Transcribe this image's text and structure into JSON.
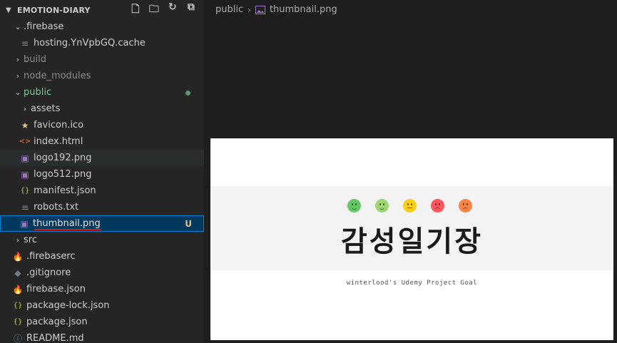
{
  "explorer": {
    "project_title": "EMOTION-DIARY",
    "actions": [
      "new-file-icon",
      "new-folder-icon",
      "refresh-icon",
      "collapse-all-icon"
    ]
  },
  "tree": {
    "firebase_folder": ".firebase",
    "hosting_cache": "hosting.YnVpbGQ.cache",
    "build": "build",
    "node_modules": "node_modules",
    "public": "public",
    "assets": "assets",
    "favicon": "favicon.ico",
    "index_html": "index.html",
    "logo192": "logo192.png",
    "logo512": "logo512.png",
    "manifest": "manifest.json",
    "robots": "robots.txt",
    "thumbnail": "thumbnail.png",
    "thumbnail_badge": "U",
    "src": "src",
    "firebaserc": ".firebaserc",
    "gitignore": ".gitignore",
    "firebase_json": "firebase.json",
    "package_lock": "package-lock.json",
    "package_json": "package.json",
    "readme": "README.md"
  },
  "breadcrumb": {
    "folder": "public",
    "file": "thumbnail.png"
  },
  "preview": {
    "title": "감성일기장",
    "subtitle": "winterlood's Udemy Project Goal",
    "face_colors": [
      "#64c964",
      "#9dd772",
      "#fdce17",
      "#fd8446",
      "#fd565f"
    ]
  },
  "colors": {
    "accent_selected": "#04395e",
    "git_untracked": "#73c991",
    "git_badge": "#e2c08d"
  }
}
